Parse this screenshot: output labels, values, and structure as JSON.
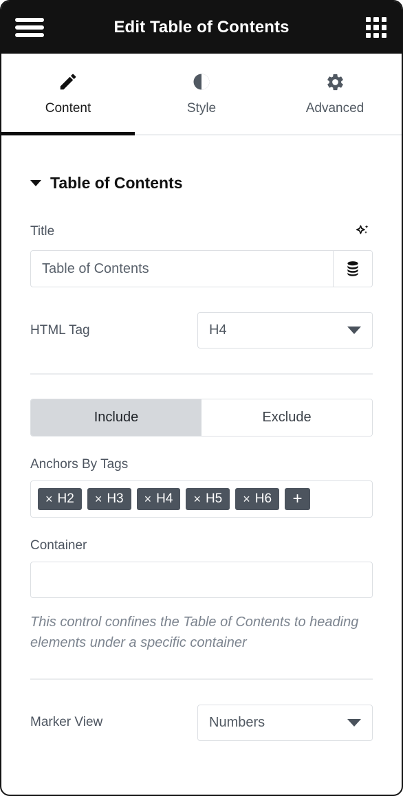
{
  "titlebar": {
    "menu_icon": "hamburger-menu-icon",
    "title": "Edit Table of Contents",
    "apps_icon": "apps-grid-icon"
  },
  "tabs": [
    {
      "label": "Content",
      "icon": "pencil-icon",
      "active": true
    },
    {
      "label": "Style",
      "icon": "contrast-icon",
      "active": false
    },
    {
      "label": "Advanced",
      "icon": "gear-icon",
      "active": false
    }
  ],
  "section": {
    "title": "Table of Contents",
    "caret_icon": "caret-down-icon",
    "expanded": true
  },
  "title_field": {
    "label": "Title",
    "ai_icon": "sparkle-ai-icon",
    "value": "Table of Contents",
    "placeholder": "Table of Contents",
    "addon_icon": "database-icon"
  },
  "html_tag": {
    "label": "HTML Tag",
    "value": "H4",
    "caret_icon": "chevron-down-icon"
  },
  "include_exclude": {
    "options": [
      {
        "label": "Include",
        "active": true
      },
      {
        "label": "Exclude",
        "active": false
      }
    ]
  },
  "anchors": {
    "label": "Anchors By Tags",
    "chips": [
      {
        "remove_icon": "close-icon",
        "label": "H2"
      },
      {
        "remove_icon": "close-icon",
        "label": "H3"
      },
      {
        "remove_icon": "close-icon",
        "label": "H4"
      },
      {
        "remove_icon": "close-icon",
        "label": "H5"
      },
      {
        "remove_icon": "close-icon",
        "label": "H6"
      }
    ],
    "add_label": "+"
  },
  "container": {
    "label": "Container",
    "value": "",
    "placeholder": "",
    "help": "This control confines the Table of Contents to heading elements under a specific container"
  },
  "marker_view": {
    "label": "Marker View",
    "value": "Numbers",
    "caret_icon": "chevron-down-icon"
  },
  "colors": {
    "titlebar_bg": "#121212",
    "panel_border": "#121212",
    "active_tab_underline": "#0c0c0c",
    "chip_bg": "#4c545e",
    "segment_active_bg": "#d5d8dc",
    "label_text": "#4d5560",
    "help_text": "#7c848f",
    "input_border": "#dcdfe3"
  }
}
